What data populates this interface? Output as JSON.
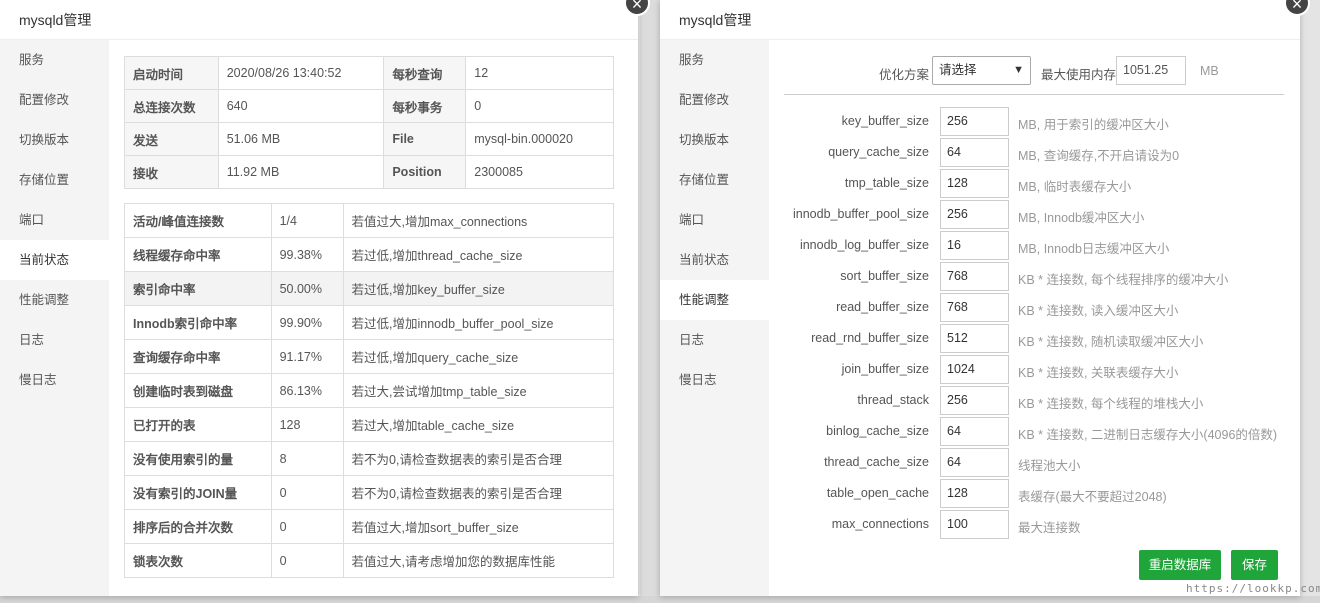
{
  "left_panel": {
    "title": "mysqld管理",
    "sidebar": [
      "服务",
      "配置修改",
      "切换版本",
      "存储位置",
      "端口",
      "当前状态",
      "性能调整",
      "日志",
      "慢日志"
    ],
    "active_index": 5,
    "status_table": [
      [
        "启动时间",
        "2020/08/26 13:40:52",
        "每秒查询",
        "12"
      ],
      [
        "总连接次数",
        "640",
        "每秒事务",
        "0"
      ],
      [
        "发送",
        "51.06 MB",
        "File",
        "mysql-bin.000020"
      ],
      [
        "接收",
        "11.92 MB",
        "Position",
        "2300085"
      ]
    ],
    "metrics_table": [
      [
        "活动/峰值连接数",
        "1/4",
        "若值过大,增加max_connections"
      ],
      [
        "线程缓存命中率",
        "99.38%",
        "若过低,增加thread_cache_size"
      ],
      [
        "索引命中率",
        "50.00%",
        "若过低,增加key_buffer_size"
      ],
      [
        "Innodb索引命中率",
        "99.90%",
        "若过低,增加innodb_buffer_pool_size"
      ],
      [
        "查询缓存命中率",
        "91.17%",
        "若过低,增加query_cache_size"
      ],
      [
        "创建临时表到磁盘",
        "86.13%",
        "若过大,尝试增加tmp_table_size"
      ],
      [
        "已打开的表",
        "128",
        "若过大,增加table_cache_size"
      ],
      [
        "没有使用索引的量",
        "8",
        "若不为0,请检查数据表的索引是否合理"
      ],
      [
        "没有索引的JOIN量",
        "0",
        "若不为0,请检查数据表的索引是否合理"
      ],
      [
        "排序后的合并次数",
        "0",
        "若值过大,增加sort_buffer_size"
      ],
      [
        "锁表次数",
        "0",
        "若值过大,请考虑增加您的数据库性能"
      ]
    ]
  },
  "right_panel": {
    "title": "mysqld管理",
    "sidebar": [
      "服务",
      "配置修改",
      "切换版本",
      "存储位置",
      "端口",
      "当前状态",
      "性能调整",
      "日志",
      "慢日志"
    ],
    "active_index": 6,
    "optimize_label": "优化方案",
    "optimize_select": "请选择",
    "max_mem_label": "最大使用内存",
    "max_mem_value": "1051.25",
    "max_mem_unit": "MB",
    "params": [
      [
        "key_buffer_size",
        "256",
        "MB, 用于索引的缓冲区大小"
      ],
      [
        "query_cache_size",
        "64",
        "MB, 查询缓存,不开启请设为0"
      ],
      [
        "tmp_table_size",
        "128",
        "MB, 临时表缓存大小"
      ],
      [
        "innodb_buffer_pool_size",
        "256",
        "MB, Innodb缓冲区大小"
      ],
      [
        "innodb_log_buffer_size",
        "16",
        "MB, Innodb日志缓冲区大小"
      ],
      [
        "sort_buffer_size",
        "768",
        "KB * 连接数, 每个线程排序的缓冲大小"
      ],
      [
        "read_buffer_size",
        "768",
        "KB * 连接数, 读入缓冲区大小"
      ],
      [
        "read_rnd_buffer_size",
        "512",
        "KB * 连接数, 随机读取缓冲区大小"
      ],
      [
        "join_buffer_size",
        "1024",
        "KB * 连接数, 关联表缓存大小"
      ],
      [
        "thread_stack",
        "256",
        "KB * 连接数, 每个线程的堆栈大小"
      ],
      [
        "binlog_cache_size",
        "64",
        "KB * 连接数, 二进制日志缓存大小(4096的倍数)"
      ],
      [
        "thread_cache_size",
        "64",
        "线程池大小"
      ],
      [
        "table_open_cache",
        "128",
        "表缓存(最大不要超过2048)"
      ],
      [
        "max_connections",
        "100",
        "最大连接数"
      ]
    ],
    "restart_button": "重启数据库",
    "save_button": "保存"
  },
  "close_glyph": "×",
  "watermark": "https://lookkp.com"
}
